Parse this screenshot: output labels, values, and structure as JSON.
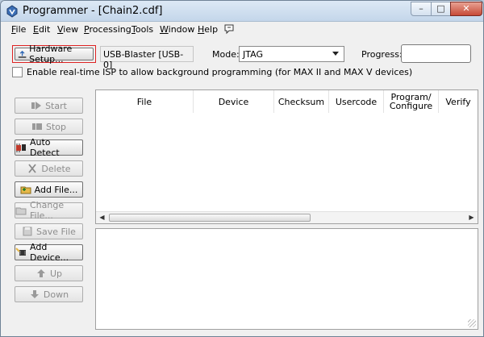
{
  "window": {
    "title": "Programmer - [Chain2.cdf]",
    "controls": {
      "minimize": "–",
      "maximize": "□",
      "close": "✕"
    }
  },
  "menu": [
    {
      "key": "F",
      "rest": "ile"
    },
    {
      "key": "E",
      "rest": "dit"
    },
    {
      "key": "V",
      "rest": "iew"
    },
    {
      "key": "P",
      "rest": "rocessing"
    },
    {
      "key": "T",
      "rest": "ools"
    },
    {
      "key": "W",
      "rest": "indow"
    },
    {
      "key": "H",
      "rest": "elp"
    }
  ],
  "setup": {
    "hardware_button": "Hardware Setup...",
    "hardware_value": "USB-Blaster [USB-0]",
    "mode_label": "Mode:",
    "mode_value": "JTAG",
    "progress_label": "Progress:",
    "isp_label": "Enable real-time ISP to allow background programming (for MAX II and MAX V devices)",
    "isp_checked": false
  },
  "actions": [
    {
      "id": "start",
      "label": "Start",
      "enabled": false,
      "icon": "play-icon"
    },
    {
      "id": "stop",
      "label": "Stop",
      "enabled": false,
      "icon": "stop-icon"
    },
    {
      "id": "auto-detect",
      "label": "Auto Detect",
      "enabled": true,
      "icon": "chip-detect-icon"
    },
    {
      "id": "delete",
      "label": "Delete",
      "enabled": false,
      "icon": "x-icon"
    },
    {
      "id": "add-file",
      "label": "Add File...",
      "enabled": true,
      "icon": "folder-add-icon"
    },
    {
      "id": "change-file",
      "label": "Change File...",
      "enabled": false,
      "icon": "folder-edit-icon"
    },
    {
      "id": "save-file",
      "label": "Save File",
      "enabled": false,
      "icon": "disk-icon"
    },
    {
      "id": "add-device",
      "label": "Add Device...",
      "enabled": true,
      "icon": "device-add-icon"
    },
    {
      "id": "up",
      "label": "Up",
      "enabled": false,
      "icon": "arrow-up-icon"
    },
    {
      "id": "down",
      "label": "Down",
      "enabled": false,
      "icon": "arrow-down-icon"
    }
  ],
  "table": {
    "columns": [
      "File",
      "Device",
      "Checksum",
      "Usercode",
      "Program/ Configure",
      "Verify"
    ],
    "rows": []
  },
  "colors": {
    "highlight_border": "#dd2222",
    "close_button": "#c74a37"
  }
}
